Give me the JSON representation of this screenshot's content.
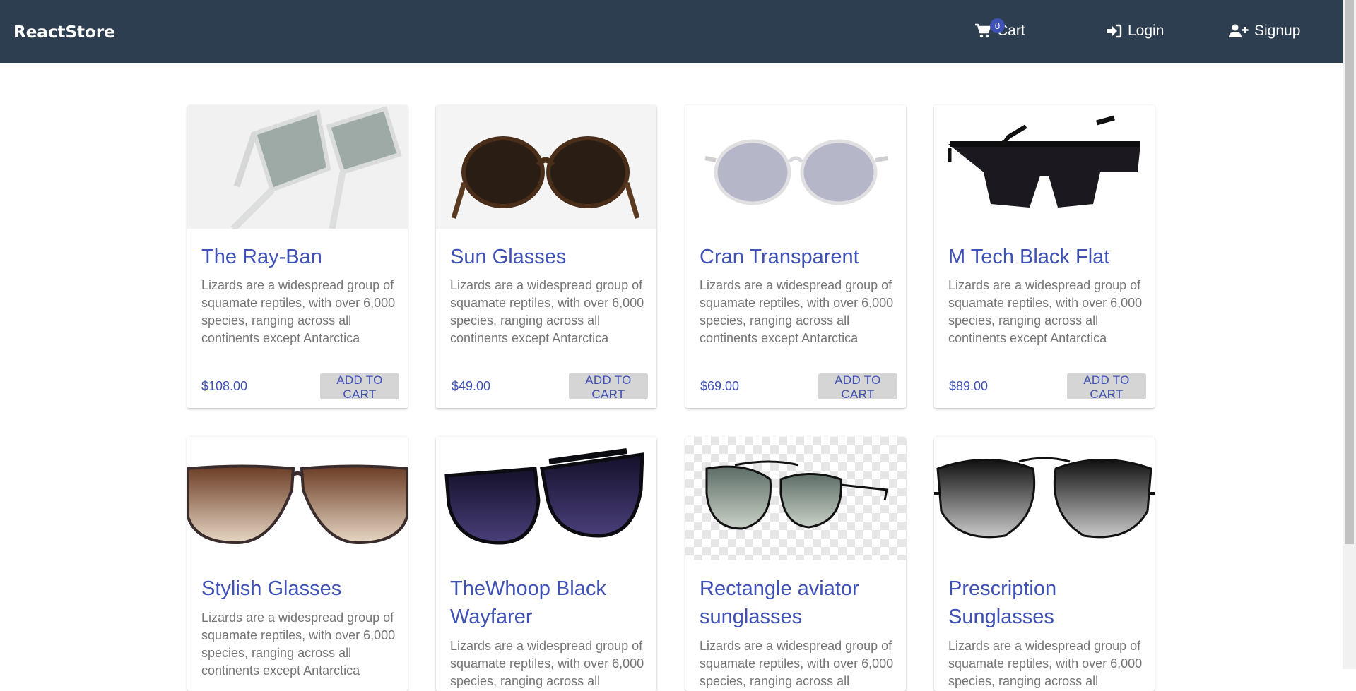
{
  "navbar": {
    "brand": "ReactStore",
    "cart_label": "Cart",
    "cart_count": "0",
    "login_label": "Login",
    "signup_label": "Signup"
  },
  "products": [
    {
      "title": "The Ray-Ban",
      "description": "Lizards are a widespread group of squamate reptiles, with over 6,000 species, ranging across all continents except Antarctica",
      "price": "$108.00",
      "button": "ADD TO CART"
    },
    {
      "title": "Sun Glasses",
      "description": "Lizards are a widespread group of squamate reptiles, with over 6,000 species, ranging across all continents except Antarctica",
      "price": "$49.00",
      "button": "ADD TO CART"
    },
    {
      "title": "Cran Transparent",
      "description": "Lizards are a widespread group of squamate reptiles, with over 6,000 species, ranging across all continents except Antarctica",
      "price": "$69.00",
      "button": "ADD TO CART"
    },
    {
      "title": "M Tech Black Flat",
      "description": "Lizards are a widespread group of squamate reptiles, with over 6,000 species, ranging across all continents except Antarctica",
      "price": "$89.00",
      "button": "ADD TO CART"
    },
    {
      "title": "Stylish Glasses",
      "description": "Lizards are a widespread group of squamate reptiles, with over 6,000 species, ranging across all continents except Antarctica"
    },
    {
      "title": "TheWhoop Black Wayfarer",
      "description": "Lizards are a widespread group of squamate reptiles, with over 6,000 species, ranging across all continents except Antarctica"
    },
    {
      "title": "Rectangle aviator sunglasses",
      "description": "Lizards are a widespread group of squamate reptiles, with over 6,000 species, ranging across all continents except Antarctica"
    },
    {
      "title": "Prescription Sunglasses",
      "description": "Lizards are a widespread group of squamate reptiles, with over 6,000 species, ranging across all continents except Antarctica"
    }
  ],
  "colors": {
    "navbar_bg": "#2d3e50",
    "primary": "#3f51b5",
    "button_bg": "#d5d5d5",
    "text_muted": "#757575"
  }
}
